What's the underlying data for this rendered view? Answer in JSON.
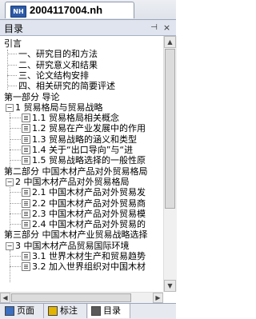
{
  "document": {
    "title": "2004117004.nh",
    "icon_text": "NH"
  },
  "panel": {
    "title": "目录",
    "pin_glyph": "⊣",
    "close_glyph": "×"
  },
  "tree": [
    {
      "text": "引言",
      "depth": 0,
      "type": "plain"
    },
    {
      "text": "一、研究目的和方法",
      "depth": 1,
      "type": "line"
    },
    {
      "text": "二、研究意义和结果",
      "depth": 1,
      "type": "line"
    },
    {
      "text": "三、论文结构安排",
      "depth": 1,
      "type": "line"
    },
    {
      "text": "四、相关研究的简要评述",
      "depth": 1,
      "type": "line"
    },
    {
      "text": "第一部分 导论",
      "depth": 0,
      "type": "plain"
    },
    {
      "text": "1 贸易格局与贸易战略",
      "depth": 0,
      "type": "expander"
    },
    {
      "text": "1.1 贸易格局相关概念",
      "depth": 2,
      "type": "leaf"
    },
    {
      "text": "1.2 贸易在产业发展中的作用",
      "depth": 2,
      "type": "leaf"
    },
    {
      "text": "1.3 贸易战略的涵义和类型",
      "depth": 2,
      "type": "leaf"
    },
    {
      "text": "1.4 关于“出口导向”与“进",
      "depth": 2,
      "type": "leaf"
    },
    {
      "text": "1.5 贸易战略选择的一般性原",
      "depth": 2,
      "type": "leaf"
    },
    {
      "text": "第二部分 中国木材产品对外贸易格局",
      "depth": 0,
      "type": "plain"
    },
    {
      "text": "2 中国木材产品对外贸易格局",
      "depth": 0,
      "type": "expander"
    },
    {
      "text": "2.1 中国木材产品对外贸易发",
      "depth": 2,
      "type": "leaf"
    },
    {
      "text": "2.2 中国木材产品对外贸易商",
      "depth": 2,
      "type": "leaf"
    },
    {
      "text": "2.3 中国木材产品对外贸易模",
      "depth": 2,
      "type": "leaf"
    },
    {
      "text": "2.4 中国木材产品对外贸易的",
      "depth": 2,
      "type": "leaf"
    },
    {
      "text": "第三部分 中国木材产业贸易战略选择",
      "depth": 0,
      "type": "plain"
    },
    {
      "text": "3 中国木材产品贸易国际环境",
      "depth": 0,
      "type": "expander"
    },
    {
      "text": "3.1 世界木材生产和贸易趋势",
      "depth": 2,
      "type": "leaf"
    },
    {
      "text": "3.2 加入世界组织对中国木材",
      "depth": 2,
      "type": "leaf"
    }
  ],
  "tabs": [
    {
      "label": "页面",
      "active": false,
      "icon_color": "#3a6fc2"
    },
    {
      "label": "标注",
      "active": false,
      "icon_color": "#e2b400"
    },
    {
      "label": "目录",
      "active": true,
      "icon_color": "#5a5a5a"
    }
  ]
}
